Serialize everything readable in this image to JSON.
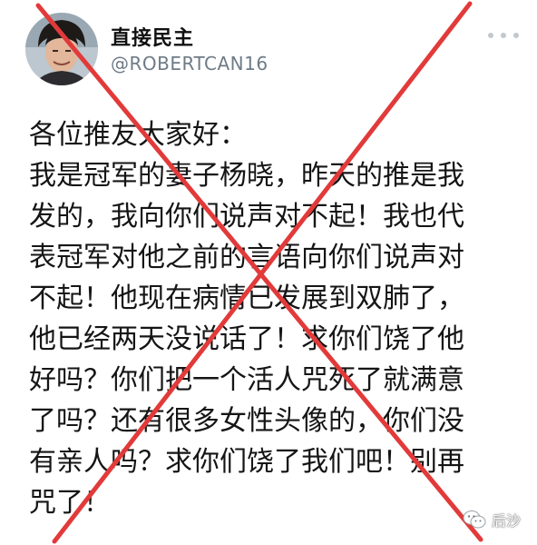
{
  "post": {
    "display_name": "直接民主",
    "handle": "@ROBERTCAN16",
    "avatar_icon": "profile-avatar",
    "more_icon": "more-options-icon",
    "lines": [
      "各位推友大家好：",
      "我是冠军的妻子杨晓，昨天的推是我",
      "发的，我向你们说声对不起！我也代",
      "表冠军对他之前的言语向你们说声对",
      "不起！他现在病情已发展到双肺了，",
      "他已经两天没说话了！求你们饶了他",
      "好吗？你们把一个活人咒死了就满意",
      "了吗？还有很多女性头像的，你们没",
      "有亲人吗？求你们饶了我们吧！别再",
      "咒了！"
    ]
  },
  "overlay": {
    "cross_color": "#e23a3a"
  },
  "watermark": {
    "icon": "wechat-icon",
    "text": "后沙"
  }
}
